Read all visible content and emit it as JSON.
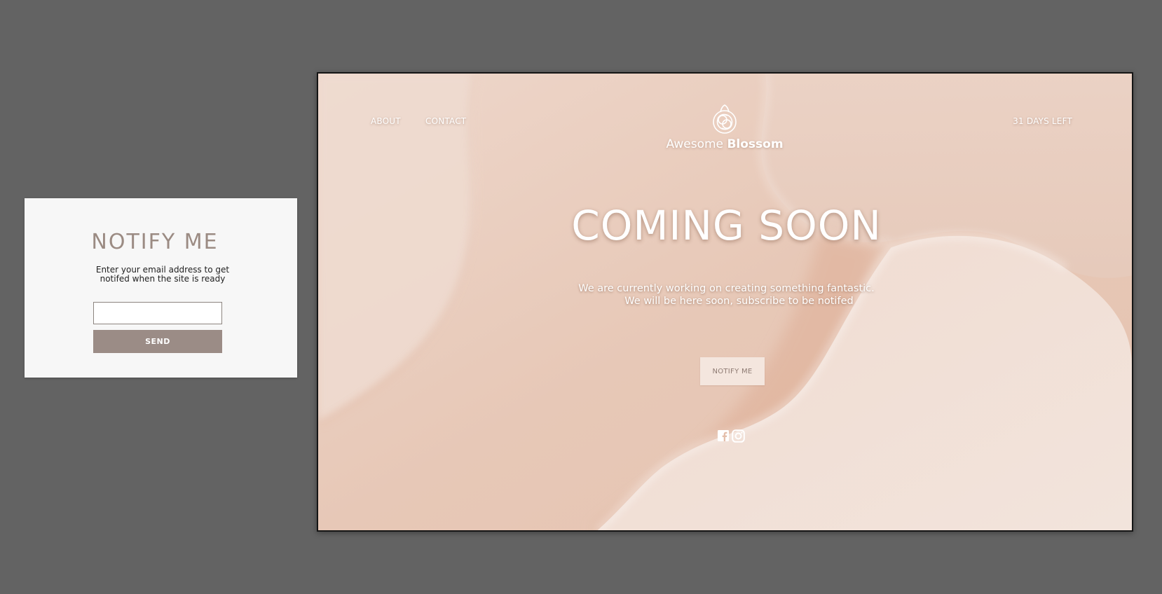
{
  "modal": {
    "title": "NOTIFY  ME",
    "description_line1": "Enter your email address to get",
    "description_line2": "notifed when the site is ready",
    "email_value": "",
    "send_label": "SEND"
  },
  "landing": {
    "nav": {
      "about_label": "ABOUT",
      "contact_label": "CONTACT"
    },
    "countdown_label": "31 DAYS LEFT",
    "logo": {
      "icon": "knot-flower-icon",
      "light_text": "Awesome",
      "bold_text": "Blossom"
    },
    "headline": "COMING SOON",
    "tagline_line1": "We are currently working on creating something fantastic.",
    "tagline_line2": "We will be here soon, subscribe to be notifed",
    "notify_label": "NOTIFY ME",
    "social": {
      "facebook_icon": "facebook-icon",
      "instagram_icon": "instagram-icon"
    }
  },
  "colors": {
    "desktop_background": "#636363",
    "modal_background": "#f7f7f7",
    "accent_taupe": "#9b8c86",
    "landing_background": "#e9cbbb",
    "notify_button_background": "#f4e6de"
  }
}
